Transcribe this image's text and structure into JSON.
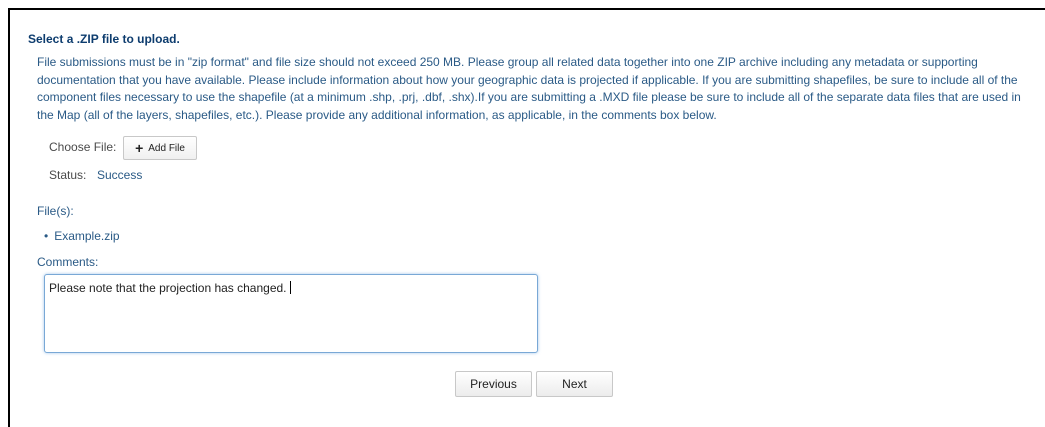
{
  "upload": {
    "title": "Select a .ZIP file to upload.",
    "instructions": "File submissions must be in \"zip format\" and file size should not exceed 250 MB. Please group all related data together into one ZIP archive including any metadata or supporting documentation that you have available. Please include information about how your geographic data is projected if applicable. If you are submitting shapefiles, be sure to include all of the component files necessary to use the shapefile (at a minimum .shp, .prj, .dbf, .shx).If you are submitting a .MXD file please be sure to include all of the separate data files that are used in the Map (all of the layers, shapefiles, etc.). Please provide any additional information, as applicable, in the comments box below.",
    "choose_file_label": "Choose File:",
    "add_file_button": "Add File",
    "status_label": "Status:",
    "status_value": "Success",
    "files_label": "File(s):",
    "files": [
      "Example.zip"
    ],
    "comments_label": "Comments:",
    "comments_value": "Please note that the projection has changed."
  },
  "nav": {
    "previous_label": "Previous",
    "next_label": "Next"
  },
  "icons": {
    "add": "plus-icon",
    "bullet": "bullet"
  },
  "colors": {
    "title": "#0d3c6e",
    "text": "#2a5a86",
    "focus_border": "#79a8d6"
  }
}
